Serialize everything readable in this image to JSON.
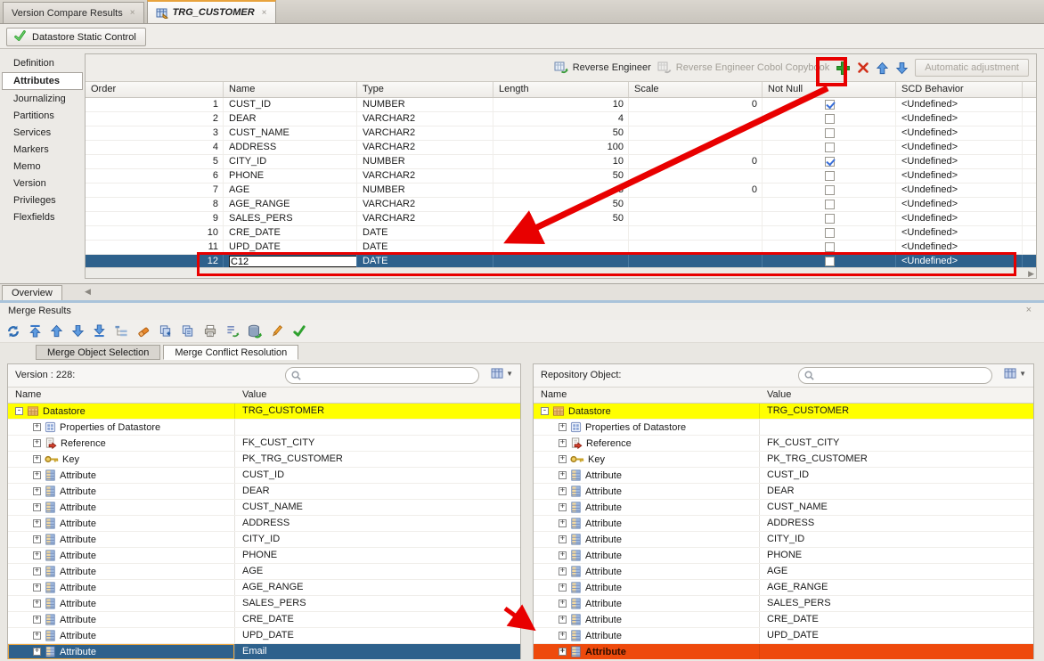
{
  "window": {
    "tabs": [
      {
        "label": "Version Compare Results",
        "close": "×"
      },
      {
        "label": "TRG_CUSTOMER",
        "close": "×"
      }
    ],
    "control_button": "Datastore Static Control"
  },
  "sidebar": {
    "items": [
      "Definition",
      "Attributes",
      "Journalizing",
      "Partitions",
      "Services",
      "Markers",
      "Memo",
      "Version",
      "Privileges",
      "Flexfields"
    ],
    "selected": "Attributes"
  },
  "editor": {
    "toolbar": {
      "reverse_engineer": "Reverse Engineer",
      "reverse_engineer_cobol": "Reverse Engineer Cobol Copybook",
      "automatic_adjustment": "Automatic adjustment"
    },
    "columns": [
      "Order",
      "Name",
      "Type",
      "Length",
      "Scale",
      "Not Null",
      "SCD Behavior"
    ],
    "rows": [
      {
        "order": "1",
        "name": "CUST_ID",
        "type": "NUMBER",
        "length": "10",
        "scale": "0",
        "not_null": true,
        "scd": "<Undefined>"
      },
      {
        "order": "2",
        "name": "DEAR",
        "type": "VARCHAR2",
        "length": "4",
        "scale": "",
        "not_null": false,
        "scd": "<Undefined>"
      },
      {
        "order": "3",
        "name": "CUST_NAME",
        "type": "VARCHAR2",
        "length": "50",
        "scale": "",
        "not_null": false,
        "scd": "<Undefined>"
      },
      {
        "order": "4",
        "name": "ADDRESS",
        "type": "VARCHAR2",
        "length": "100",
        "scale": "",
        "not_null": false,
        "scd": "<Undefined>"
      },
      {
        "order": "5",
        "name": "CITY_ID",
        "type": "NUMBER",
        "length": "10",
        "scale": "0",
        "not_null": true,
        "scd": "<Undefined>"
      },
      {
        "order": "6",
        "name": "PHONE",
        "type": "VARCHAR2",
        "length": "50",
        "scale": "",
        "not_null": false,
        "scd": "<Undefined>"
      },
      {
        "order": "7",
        "name": "AGE",
        "type": "NUMBER",
        "length": "3",
        "scale": "0",
        "not_null": false,
        "scd": "<Undefined>"
      },
      {
        "order": "8",
        "name": "AGE_RANGE",
        "type": "VARCHAR2",
        "length": "50",
        "scale": "",
        "not_null": false,
        "scd": "<Undefined>"
      },
      {
        "order": "9",
        "name": "SALES_PERS",
        "type": "VARCHAR2",
        "length": "50",
        "scale": "",
        "not_null": false,
        "scd": "<Undefined>"
      },
      {
        "order": "10",
        "name": "CRE_DATE",
        "type": "DATE",
        "length": "",
        "scale": "",
        "not_null": false,
        "scd": "<Undefined>"
      },
      {
        "order": "11",
        "name": "UPD_DATE",
        "type": "DATE",
        "length": "",
        "scale": "",
        "not_null": false,
        "scd": "<Undefined>"
      }
    ],
    "editing_row": {
      "order": "12",
      "name_value": "C12",
      "type": "DATE",
      "length": "",
      "scale": "",
      "not_null": false,
      "scd": "<Undefined>"
    }
  },
  "overview_tab": "Overview",
  "merge": {
    "title": "Merge Results",
    "close": "×",
    "toolbar_icons": [
      "merge-sync-icon",
      "go-first-icon",
      "go-previous-icon",
      "go-next-icon",
      "go-last-icon",
      "tree-view-icon",
      "eraser-icon",
      "copy-add-icon",
      "copy-icon",
      "print-icon",
      "restore-list-icon",
      "database-refresh-icon",
      "edit-pencil-icon",
      "accept-check-icon"
    ],
    "tabs": [
      "Merge Object Selection",
      "Merge Conflict Resolution"
    ],
    "left": {
      "title": "Version : 228:",
      "columns": [
        "Name",
        "Value"
      ],
      "rows": [
        {
          "icon": "datastore",
          "label": "Datastore",
          "value": "TRG_CUSTOMER",
          "expander": "-",
          "indent": 0,
          "highlight": "yellow"
        },
        {
          "icon": "properties",
          "label": "Properties of Datastore",
          "value": "",
          "expander": "+",
          "indent": 1,
          "highlight": ""
        },
        {
          "icon": "reference",
          "label": "Reference",
          "value": "FK_CUST_CITY",
          "expander": "+",
          "indent": 1,
          "highlight": ""
        },
        {
          "icon": "key",
          "label": "Key",
          "value": "PK_TRG_CUSTOMER",
          "expander": "+",
          "indent": 1,
          "highlight": ""
        },
        {
          "icon": "attribute",
          "label": "Attribute",
          "value": "CUST_ID",
          "expander": "+",
          "indent": 1,
          "highlight": ""
        },
        {
          "icon": "attribute",
          "label": "Attribute",
          "value": "DEAR",
          "expander": "+",
          "indent": 1,
          "highlight": ""
        },
        {
          "icon": "attribute",
          "label": "Attribute",
          "value": "CUST_NAME",
          "expander": "+",
          "indent": 1,
          "highlight": ""
        },
        {
          "icon": "attribute",
          "label": "Attribute",
          "value": "ADDRESS",
          "expander": "+",
          "indent": 1,
          "highlight": ""
        },
        {
          "icon": "attribute",
          "label": "Attribute",
          "value": "CITY_ID",
          "expander": "+",
          "indent": 1,
          "highlight": ""
        },
        {
          "icon": "attribute",
          "label": "Attribute",
          "value": "PHONE",
          "expander": "+",
          "indent": 1,
          "highlight": ""
        },
        {
          "icon": "attribute",
          "label": "Attribute",
          "value": "AGE",
          "expander": "+",
          "indent": 1,
          "highlight": ""
        },
        {
          "icon": "attribute",
          "label": "Attribute",
          "value": "AGE_RANGE",
          "expander": "+",
          "indent": 1,
          "highlight": ""
        },
        {
          "icon": "attribute",
          "label": "Attribute",
          "value": "SALES_PERS",
          "expander": "+",
          "indent": 1,
          "highlight": ""
        },
        {
          "icon": "attribute",
          "label": "Attribute",
          "value": "CRE_DATE",
          "expander": "+",
          "indent": 1,
          "highlight": ""
        },
        {
          "icon": "attribute",
          "label": "Attribute",
          "value": "UPD_DATE",
          "expander": "+",
          "indent": 1,
          "highlight": ""
        },
        {
          "icon": "attribute",
          "label": "Attribute",
          "value": "Email",
          "expander": "+",
          "indent": 1,
          "highlight": "sel"
        }
      ]
    },
    "right": {
      "title": "Repository Object:",
      "columns": [
        "Name",
        "Value"
      ],
      "rows": [
        {
          "icon": "datastore",
          "label": "Datastore",
          "value": "TRG_CUSTOMER",
          "expander": "-",
          "indent": 0,
          "highlight": "yellow"
        },
        {
          "icon": "properties",
          "label": "Properties of Datastore",
          "value": "",
          "expander": "+",
          "indent": 1,
          "highlight": ""
        },
        {
          "icon": "reference",
          "label": "Reference",
          "value": "FK_CUST_CITY",
          "expander": "+",
          "indent": 1,
          "highlight": ""
        },
        {
          "icon": "key",
          "label": "Key",
          "value": "PK_TRG_CUSTOMER",
          "expander": "+",
          "indent": 1,
          "highlight": ""
        },
        {
          "icon": "attribute",
          "label": "Attribute",
          "value": "CUST_ID",
          "expander": "+",
          "indent": 1,
          "highlight": ""
        },
        {
          "icon": "attribute",
          "label": "Attribute",
          "value": "DEAR",
          "expander": "+",
          "indent": 1,
          "highlight": ""
        },
        {
          "icon": "attribute",
          "label": "Attribute",
          "value": "CUST_NAME",
          "expander": "+",
          "indent": 1,
          "highlight": ""
        },
        {
          "icon": "attribute",
          "label": "Attribute",
          "value": "ADDRESS",
          "expander": "+",
          "indent": 1,
          "highlight": ""
        },
        {
          "icon": "attribute",
          "label": "Attribute",
          "value": "CITY_ID",
          "expander": "+",
          "indent": 1,
          "highlight": ""
        },
        {
          "icon": "attribute",
          "label": "Attribute",
          "value": "PHONE",
          "expander": "+",
          "indent": 1,
          "highlight": ""
        },
        {
          "icon": "attribute",
          "label": "Attribute",
          "value": "AGE",
          "expander": "+",
          "indent": 1,
          "highlight": ""
        },
        {
          "icon": "attribute",
          "label": "Attribute",
          "value": "AGE_RANGE",
          "expander": "+",
          "indent": 1,
          "highlight": ""
        },
        {
          "icon": "attribute",
          "label": "Attribute",
          "value": "SALES_PERS",
          "expander": "+",
          "indent": 1,
          "highlight": ""
        },
        {
          "icon": "attribute",
          "label": "Attribute",
          "value": "CRE_DATE",
          "expander": "+",
          "indent": 1,
          "highlight": ""
        },
        {
          "icon": "attribute",
          "label": "Attribute",
          "value": "UPD_DATE",
          "expander": "+",
          "indent": 1,
          "highlight": ""
        },
        {
          "icon": "attribute",
          "label": "Attribute",
          "value": "",
          "expander": "+",
          "indent": 1,
          "highlight": "orange"
        }
      ]
    }
  },
  "annotations": {
    "color": "#e80000"
  }
}
